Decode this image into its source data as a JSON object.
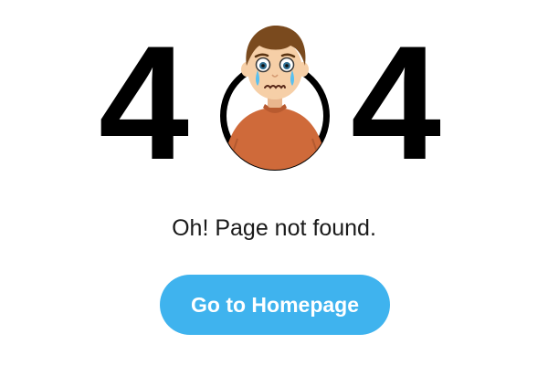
{
  "error": {
    "digit_left": "4",
    "digit_right": "4",
    "illustration": "sad-boy-crying-icon",
    "message": "Oh! Page not found."
  },
  "actions": {
    "home_label": "Go to Homepage"
  },
  "colors": {
    "accent": "#3fb3ee",
    "digits": "#000000",
    "shirt": "#cf6a3a",
    "hair": "#7a4a1e",
    "skin": "#f6cfa7"
  }
}
